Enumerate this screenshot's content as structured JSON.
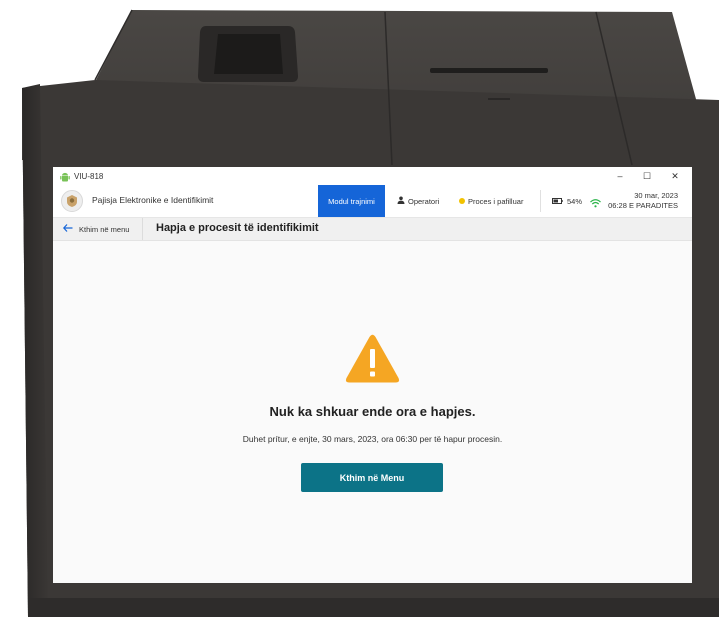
{
  "window": {
    "title": "VIU-818",
    "controls": {
      "minimize": "–",
      "maximize": "☐",
      "close": "✕"
    }
  },
  "header": {
    "app_name": "Pajisja Elektronike e Identifikimit",
    "training_mode": "Modul trajnimi",
    "operator": "Operatori",
    "process_status": "Proces i pafilluar",
    "battery": "54%",
    "date": "30 mar, 2023",
    "time": "06:28 E PARADITES"
  },
  "subbar": {
    "back_label": "Kthim në menu",
    "page_title": "Hapja e procesit të identifikimit"
  },
  "main": {
    "heading": "Nuk ka shkuar ende ora e hapjes.",
    "message": "Duhet prítur, e enjte, 30 mars, 2023, ora 06:30 per të hapur procesin.",
    "button_label": "Kthim në Menu"
  },
  "colors": {
    "accent": "#1565d8",
    "button": "#0c7387",
    "warning": "#f5a623",
    "status_dot": "#f2c200",
    "device": "#3a3735"
  },
  "icons": [
    "android-icon",
    "logo-emblem-icon",
    "person-icon",
    "status-dot-icon",
    "battery-icon",
    "wifi-icon",
    "back-arrow-icon",
    "warning-icon"
  ]
}
